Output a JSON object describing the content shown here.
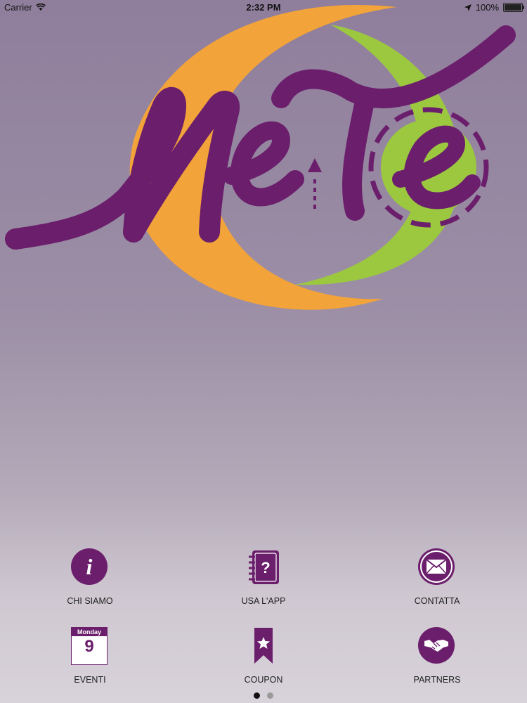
{
  "status_bar": {
    "carrier": "Carrier",
    "time": "2:32 PM",
    "battery": "100%"
  },
  "logo": {
    "text": "MeTe"
  },
  "menu": [
    {
      "label": "CHI SIAMO",
      "icon": "info-icon"
    },
    {
      "label": "USA L'APP",
      "icon": "help-book-icon"
    },
    {
      "label": "CONTATTA",
      "icon": "envelope-icon"
    },
    {
      "label": "EVENTI",
      "icon": "calendar-icon",
      "calendar_day": "Monday",
      "calendar_date": "9"
    },
    {
      "label": "COUPON",
      "icon": "bookmark-star-icon"
    },
    {
      "label": "PARTNERS",
      "icon": "handshake-icon"
    }
  ],
  "page_indicator": {
    "pages": 2,
    "current": 1
  },
  "colors": {
    "purple": "#6b1e6b",
    "orange": "#f2a33a",
    "green": "#9cc83f",
    "background": "#9c8fa6"
  }
}
